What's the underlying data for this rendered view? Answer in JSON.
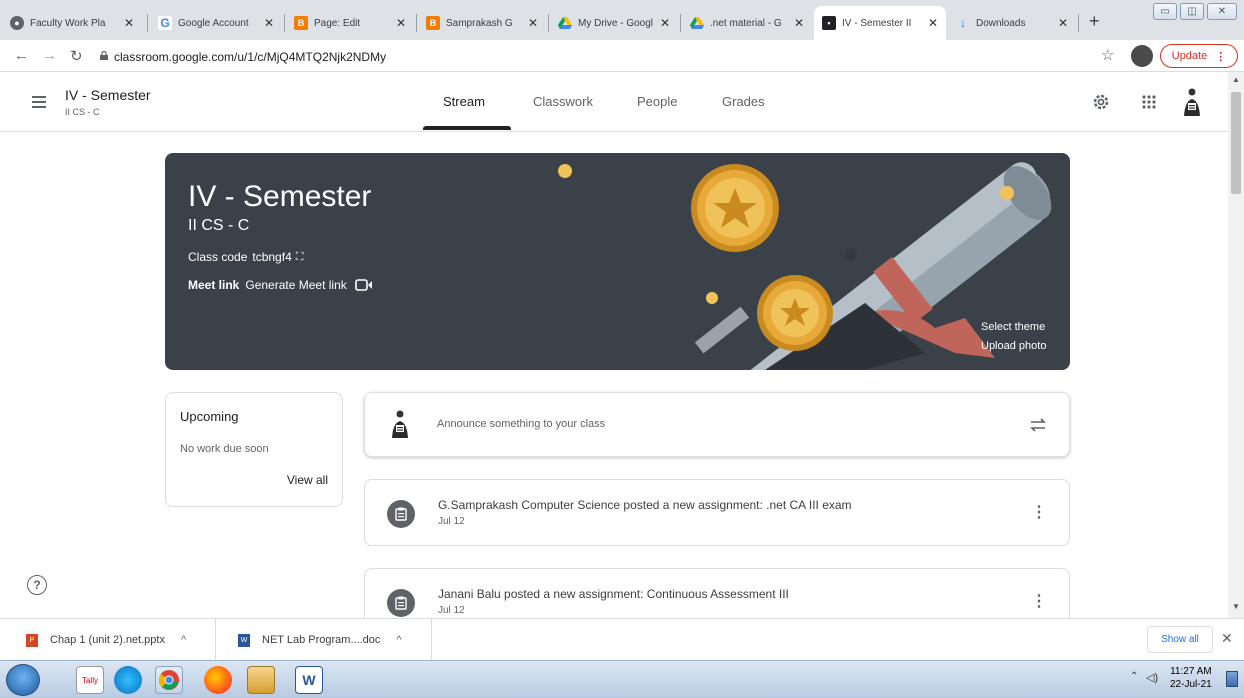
{
  "browser": {
    "tabs": [
      {
        "title": "Faculty Work Pla",
        "icon_letter": "",
        "icon_color": "#5f6368"
      },
      {
        "title": "Google Account",
        "icon_letter": "G",
        "icon_color": "#4285f4"
      },
      {
        "title": "Page: Edit",
        "icon_letter": "B",
        "icon_color": "#f57c00"
      },
      {
        "title": "Samprakash G",
        "icon_letter": "B",
        "icon_color": "#f57c00"
      },
      {
        "title": "My Drive - Googl",
        "icon_letter": "",
        "icon_color": "#0f9d58"
      },
      {
        "title": ".net material - G",
        "icon_letter": "",
        "icon_color": "#0f9d58"
      },
      {
        "title": "IV - Semester II",
        "icon_letter": "",
        "icon_color": "#202124"
      },
      {
        "title": "Downloads",
        "icon_letter": "↓",
        "icon_color": "#1a73e8"
      }
    ],
    "url": "classroom.google.com/u/1/c/MjQ4MTQ2Njk2NDMy",
    "update_label": "Update"
  },
  "classroom": {
    "class_name": "IV - Semester",
    "section": "II CS - C",
    "nav_tabs": [
      "Stream",
      "Classwork",
      "People",
      "Grades"
    ]
  },
  "banner": {
    "title": "IV - Semester",
    "section": "II CS - C",
    "class_code_label": "Class code",
    "class_code": "tcbngf4",
    "meet_link_label": "Meet link",
    "meet_action": "Generate Meet link",
    "select_theme": "Select theme",
    "upload_photo": "Upload photo"
  },
  "upcoming": {
    "title": "Upcoming",
    "status": "No work due soon",
    "view_all": "View all"
  },
  "announce": {
    "placeholder": "Announce something to your class"
  },
  "posts": [
    {
      "text": "G.Samprakash Computer Science posted a new assignment: .net CA III exam",
      "date": "Jul 12"
    },
    {
      "text": "Janani Balu posted a new assignment: Continuous Assessment III",
      "date": "Jul 12"
    }
  ],
  "downloads": [
    {
      "name": "Chap 1 (unit 2).net.pptx"
    },
    {
      "name": "NET Lab Program....doc"
    }
  ],
  "downloads_bar": {
    "show_all": "Show all"
  },
  "taskbar": {
    "time": "11:27 AM",
    "date": "22-Jul-21"
  }
}
